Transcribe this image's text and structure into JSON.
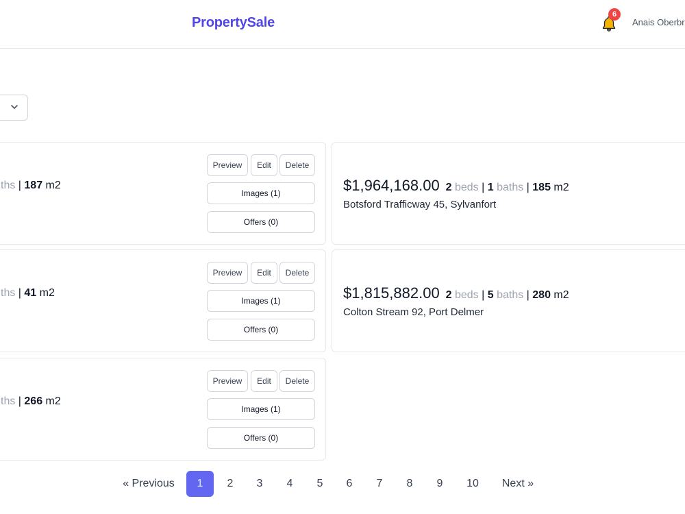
{
  "header": {
    "brand": "PropertySale",
    "notification_count": "6",
    "user_name": "Anais Oberbrunner"
  },
  "left_listings": [
    {
      "specs_tail": "ths",
      "area": "187",
      "area_unit": "m2"
    },
    {
      "specs_tail": "ths",
      "area": "41",
      "area_unit": "m2"
    },
    {
      "specs_tail": "ths",
      "area": "266",
      "area_unit": "m2"
    }
  ],
  "right_listings": [
    {
      "price": "$1,964,168.00",
      "beds": "2",
      "beds_label": "beds",
      "baths": "1",
      "baths_label": "baths",
      "area": "185",
      "area_unit": "m2",
      "address": "Botsford Trafficway 45, Sylvanfort"
    },
    {
      "price": "$1,815,882.00",
      "beds": "2",
      "beds_label": "beds",
      "baths": "5",
      "baths_label": "baths",
      "area": "280",
      "area_unit": "m2",
      "address": "Colton Stream 92, Port Delmer"
    }
  ],
  "actions": {
    "preview": "Preview",
    "edit": "Edit",
    "delete": "Delete",
    "images": "Images (1)",
    "offers": "Offers (0)"
  },
  "pagination": {
    "previous": "« Previous",
    "next": "Next »",
    "pages": [
      "1",
      "2",
      "3",
      "4",
      "5",
      "6",
      "7",
      "8",
      "9",
      "10"
    ],
    "current": "1"
  },
  "colors": {
    "brand": "#4f46e5",
    "active_page": "#6366f1",
    "badge": "#ef4444",
    "bell": "#f5b400"
  }
}
